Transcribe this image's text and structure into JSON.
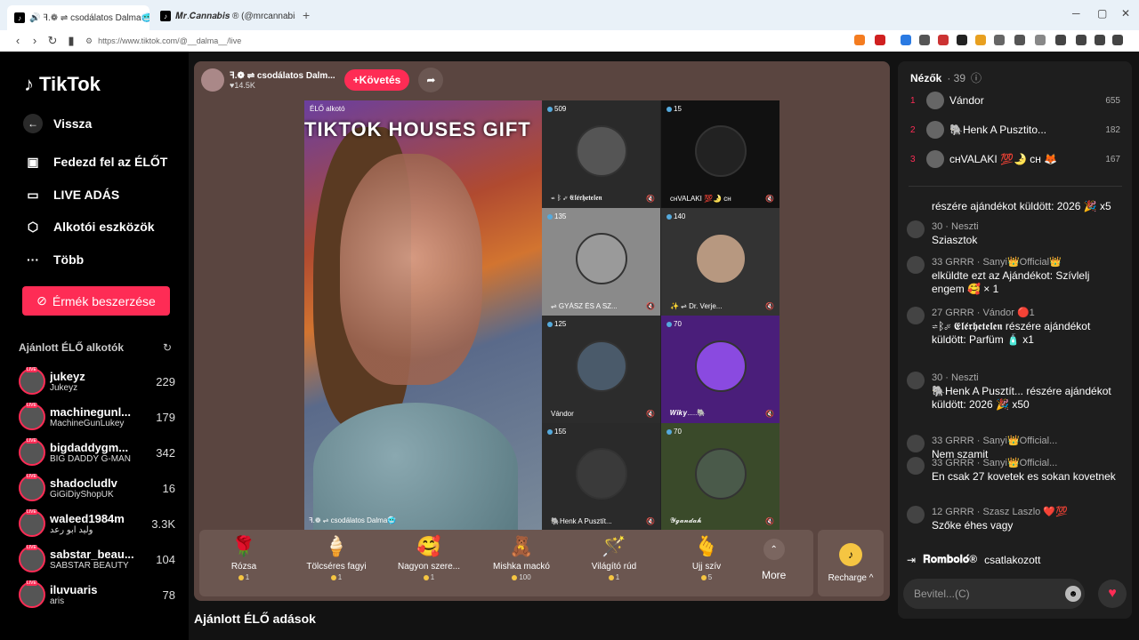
{
  "browser": {
    "tab1_title": "🔊 ꟻ.❁ ⇌ csodálatos Dalma🥶",
    "tab2_title": "𝑴𝒓.𝑪𝒂𝒏𝒏𝒂𝒃𝒊𝒔 ® (@mrcannabis_)",
    "url": "https://www.tiktok.com/@__dalma__/live"
  },
  "nav": {
    "logo": "TikTok",
    "back": "Vissza",
    "explore": "Fedezd fel az ÉLŐT",
    "live": "LIVE ADÁS",
    "tools": "Alkotói eszközök",
    "more": "Több",
    "coins": "Érmék beszerzése",
    "recommended_title": "Ajánlott ÉLŐ alkotók"
  },
  "creators": [
    {
      "user": "jukeyz",
      "display": "Jukeyz",
      "count": "229"
    },
    {
      "user": "machinegunl...",
      "display": "MachineGunLukey",
      "count": "179"
    },
    {
      "user": "bigdaddygm...",
      "display": "BIG DADDY G-MAN",
      "count": "342"
    },
    {
      "user": "shadocludlv",
      "display": "GiGiDiyShopUK",
      "count": "16"
    },
    {
      "user": "waleed1984m",
      "display": "وليد ابو رعد",
      "count": "3.3K"
    },
    {
      "user": "sabstar_beau...",
      "display": "SABSTAR BEAUTY",
      "count": "104"
    },
    {
      "user": "iluvuaris",
      "display": "aris",
      "count": "78"
    }
  ],
  "host": {
    "name": "ꟻ.❁ ⇌ csodálatos Dalm...",
    "likes": "♥14.5K",
    "follow": "+Követés"
  },
  "stream": {
    "label": "ÉLŐ alkotó",
    "banner": "TIKTOK HOUSES GIFT",
    "main_name": "ꟻ.❁ ⇌ csodálatos Dalma🥶",
    "tiles": [
      {
        "viewers": "509",
        "name": "⇌ ᛒ ☄ 𝕰𝖑𝖊́𝖗𝖍𝖊𝖙𝖊𝖑𝖊𝖓",
        "bg": "#2a2a2a",
        "av": "#555"
      },
      {
        "viewers": "15",
        "name": "cʜVALAKI 💯🌛 cʜ",
        "bg": "#111",
        "av": "#222"
      },
      {
        "viewers": "135",
        "name": "⇌ GYÁSZ ÉS A SZ...",
        "bg": "#8a8a8a",
        "av": "#9a9a9a"
      },
      {
        "viewers": "140",
        "name": "✨ ⇌ Dr. Verje...",
        "bg": "#333",
        "av": "#b79880"
      },
      {
        "viewers": "125",
        "name": "Vándor",
        "bg": "#2c2c2c",
        "av": "#4a5a6a"
      },
      {
        "viewers": "70",
        "name": "𝑾𝒊𝒌𝒚.....🐘",
        "bg": "#4a1e7a",
        "av": "#8a4ae0"
      },
      {
        "viewers": "155",
        "name": "🐘Henk A Pusztít...",
        "bg": "#2a2a2a",
        "av": "#3a3a3a"
      },
      {
        "viewers": "70",
        "name": "𝓨𝓰𝓪𝓷𝓭𝓪𝓱",
        "bg": "#3a4a2a",
        "av": "#4a5a4a"
      }
    ]
  },
  "gifts": [
    {
      "icon": "🌹",
      "name": "Rózsa",
      "price": "1"
    },
    {
      "icon": "🍦",
      "name": "Tölcséres fagyi",
      "price": "1"
    },
    {
      "icon": "🥰",
      "name": "Nagyon szere...",
      "price": "1"
    },
    {
      "icon": "🧸",
      "name": "Mishka mackó",
      "price": "100"
    },
    {
      "icon": "🪄",
      "name": "Világító rúd",
      "price": "1"
    },
    {
      "icon": "🫰",
      "name": "Ujj szív",
      "price": "5"
    }
  ],
  "gift_more": "More",
  "recharge": "Recharge ^",
  "below_title": "Ajánlott ÉLŐ adások",
  "chat": {
    "viewers_label": "Nézők",
    "viewers_count": "· 39",
    "top": [
      {
        "rank": "1",
        "name": "Vándor",
        "score": "655"
      },
      {
        "rank": "2",
        "name": "🐘Henk A Pusztito...",
        "score": "182"
      },
      {
        "rank": "3",
        "name": "cʜVALAKI 💯🌛 cʜ 🦊",
        "score": "167"
      }
    ],
    "messages": [
      {
        "meta": "",
        "text": "részére ajándékot küldött: 2026 🎉 x5"
      },
      {
        "meta": "30 · Neszti",
        "text": "Sziasztok"
      },
      {
        "meta": "33 GRRR · Sanyi👑Official👑",
        "text": "elküldte ezt az Ajándékot: Szívlelj engem 🥰 × 1"
      },
      {
        "meta": "27 GRRR · Vándor 🔴1",
        "text": "⇌ᛒ☄ 𝕰𝖑𝖊́𝖗𝖍𝖊𝖙𝖊𝖑𝖊𝖓 részére ajándékot küldött: Parfüm 🧴 x1"
      },
      {
        "meta": "30 · Neszti",
        "text": "🐘Henk A Pusztít... részére ajándékot küldött: 2026 🎉 x50"
      },
      {
        "meta": "33 GRRR · Sanyi👑Official...",
        "text": "Nem szamit"
      },
      {
        "meta": "33 GRRR · Sanyi👑Official...",
        "text": "En csak 27 kovetek es sokan kovetnek"
      },
      {
        "meta": "12 GRRR · Szasz Laszlo ❤️💯",
        "text": "Szőke éhes vagy"
      }
    ],
    "join_user": "𝐑𝐨𝐦𝐛𝐨𝐥𝐨́®",
    "join_text": "csatlakozott",
    "input_placeholder": "Bevitel...(C)"
  }
}
